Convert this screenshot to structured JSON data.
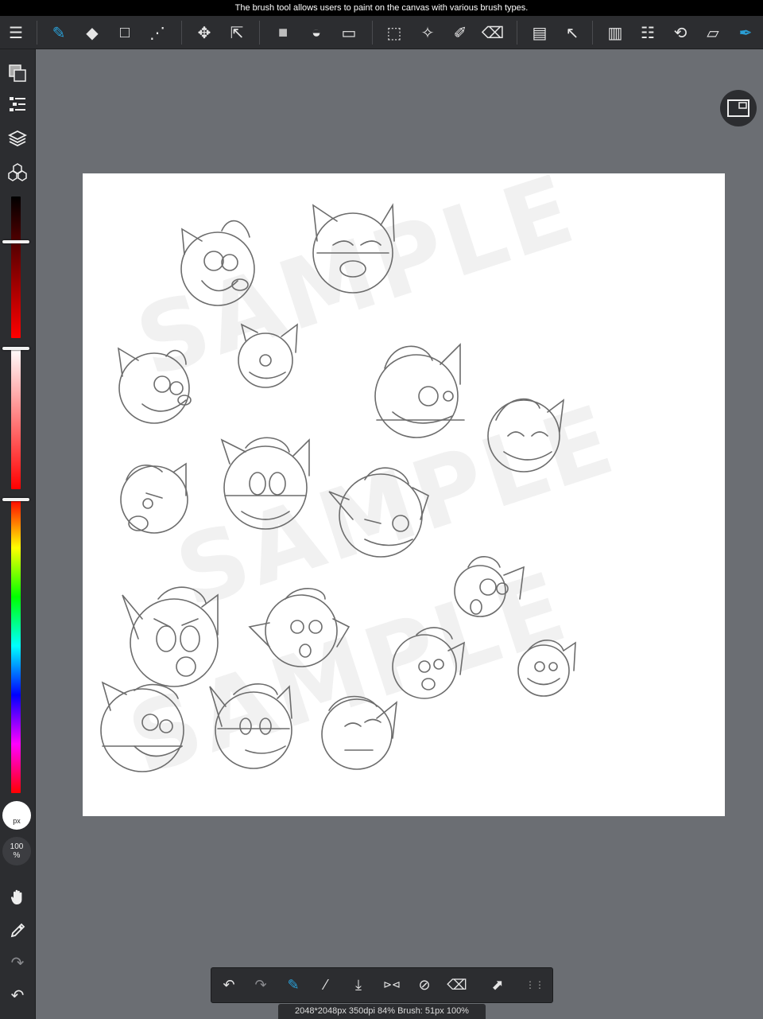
{
  "status_bar": {
    "message": "The brush tool allows users to paint on the canvas with various brush types."
  },
  "toolbar": {
    "items": [
      {
        "name": "menu",
        "glyph": "☰"
      },
      {
        "name": "brush",
        "glyph": "✎",
        "accent": true
      },
      {
        "name": "eraser",
        "glyph": "◆"
      },
      {
        "name": "shape",
        "glyph": "□"
      },
      {
        "name": "dot-pen",
        "glyph": "⋰"
      },
      {
        "name": "move",
        "glyph": "✥"
      },
      {
        "name": "transform",
        "glyph": "⇱"
      },
      {
        "name": "fill-color",
        "glyph": "■"
      },
      {
        "name": "bucket",
        "glyph": "◒"
      },
      {
        "name": "gradient",
        "glyph": "▭"
      },
      {
        "name": "select-rect",
        "glyph": "⬚"
      },
      {
        "name": "magic-wand",
        "glyph": "✧"
      },
      {
        "name": "select-pen",
        "glyph": "✐"
      },
      {
        "name": "select-eraser",
        "glyph": "⌫"
      },
      {
        "name": "panel",
        "glyph": "▤"
      },
      {
        "name": "select-layer",
        "glyph": "↖"
      },
      {
        "name": "pages",
        "glyph": "▥"
      },
      {
        "name": "selection-list",
        "glyph": "☷"
      },
      {
        "name": "rotate",
        "glyph": "⟲"
      },
      {
        "name": "ruler",
        "glyph": "▱"
      },
      {
        "name": "pen-highlight",
        "glyph": "✒",
        "accent": true
      }
    ]
  },
  "left_toolbar": {
    "brush_size_label": "px",
    "opacity_value": "100",
    "opacity_unit": "%"
  },
  "canvas": {
    "watermark_text": "SAMPLE"
  },
  "bottom_toolbar": {
    "items": [
      {
        "name": "undo",
        "glyph": "↶"
      },
      {
        "name": "redo",
        "glyph": "↷"
      },
      {
        "name": "brush-eraser-toggle",
        "glyph": "✎"
      },
      {
        "name": "eyedropper",
        "glyph": "⁄"
      },
      {
        "name": "save",
        "glyph": "⤓"
      },
      {
        "name": "flip",
        "glyph": "⊳⊲"
      },
      {
        "name": "rotate-reset",
        "glyph": "⊘"
      },
      {
        "name": "select-clear",
        "glyph": "⌫"
      },
      {
        "name": "share",
        "glyph": "⬈"
      },
      {
        "name": "more",
        "glyph": "⋮⋮"
      }
    ]
  },
  "info": {
    "canvas_info": "2048*2048px 350dpi 84% Brush: 51px 100%"
  },
  "colors": {
    "accent": "#2a9fd6",
    "panel": "#2c2d30",
    "workspace": "#6b6e73"
  }
}
